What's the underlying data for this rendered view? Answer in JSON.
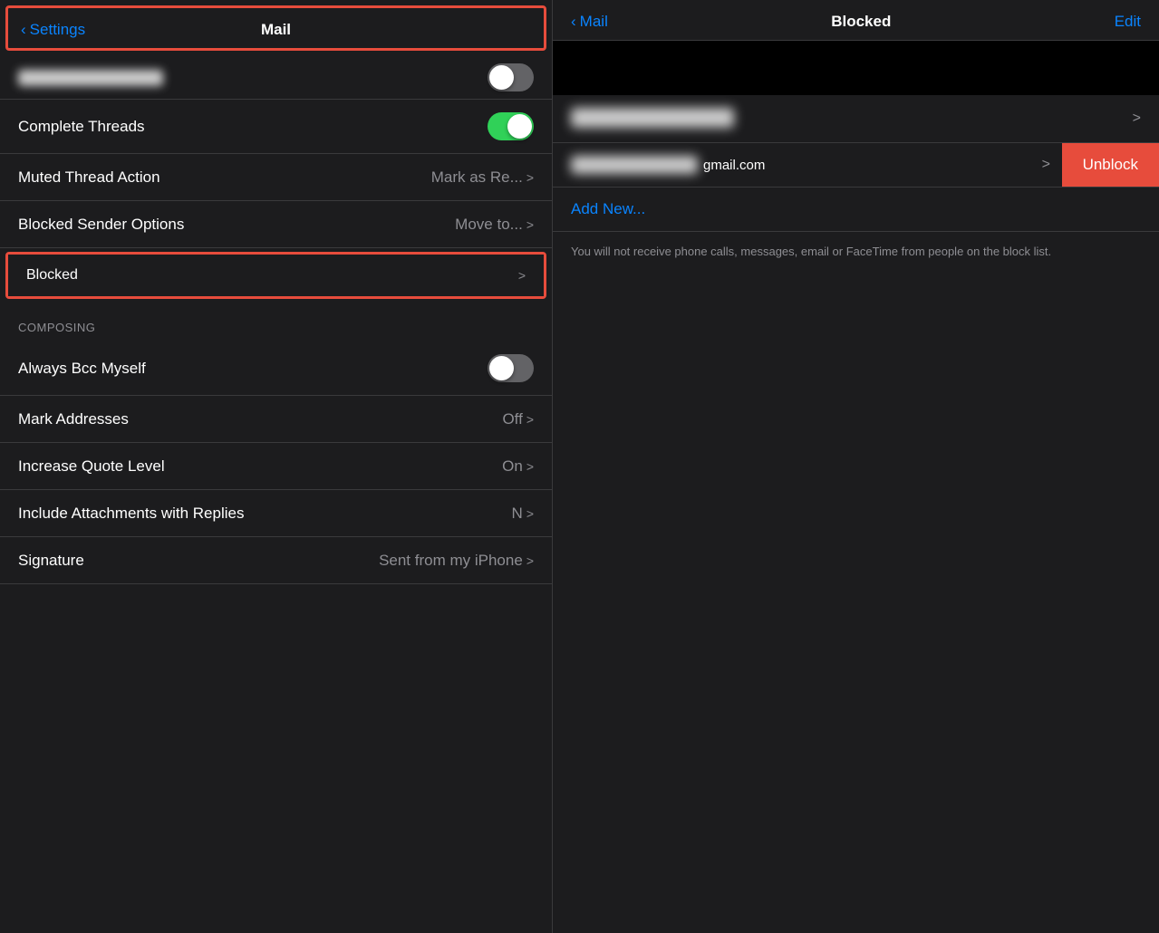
{
  "leftPanel": {
    "header": {
      "backLabel": "Settings",
      "title": "Mail"
    },
    "rows": [
      {
        "id": "complete-threads",
        "label": "Complete Threads",
        "type": "toggle",
        "toggleOn": true
      },
      {
        "id": "muted-thread-action",
        "label": "Muted Thread Action",
        "value": "Mark as Re...",
        "type": "nav"
      },
      {
        "id": "blocked-sender-options",
        "label": "Blocked Sender Options",
        "value": "Move to...",
        "type": "nav"
      },
      {
        "id": "blocked",
        "label": "Blocked",
        "type": "nav",
        "highlighted": true
      }
    ],
    "composingSection": {
      "header": "COMPOSING",
      "rows": [
        {
          "id": "always-bcc",
          "label": "Always Bcc Myself",
          "type": "toggle",
          "toggleOn": false
        },
        {
          "id": "mark-addresses",
          "label": "Mark Addresses",
          "value": "Off",
          "type": "nav"
        },
        {
          "id": "increase-quote",
          "label": "Increase Quote Level",
          "value": "On",
          "type": "nav"
        },
        {
          "id": "include-attachments",
          "label": "Include Attachments with Replies",
          "value": "N",
          "type": "nav"
        },
        {
          "id": "signature",
          "label": "Signature",
          "value": "Sent from my iPhone",
          "type": "nav"
        }
      ]
    }
  },
  "rightPanel": {
    "header": {
      "backLabel": "Mail",
      "title": "Blocked",
      "editLabel": "Edit"
    },
    "contacts": [
      {
        "id": "contact-1",
        "nameBlurred": true,
        "emailSuffix": "",
        "showUnblock": false
      },
      {
        "id": "contact-2",
        "nameBlurred": true,
        "emailSuffix": "gmail.com",
        "showUnblock": true
      }
    ],
    "addNew": "Add New...",
    "description": "You will not receive phone calls, messages, email or FaceTime from people on the block list.",
    "unblockLabel": "Unblock"
  }
}
